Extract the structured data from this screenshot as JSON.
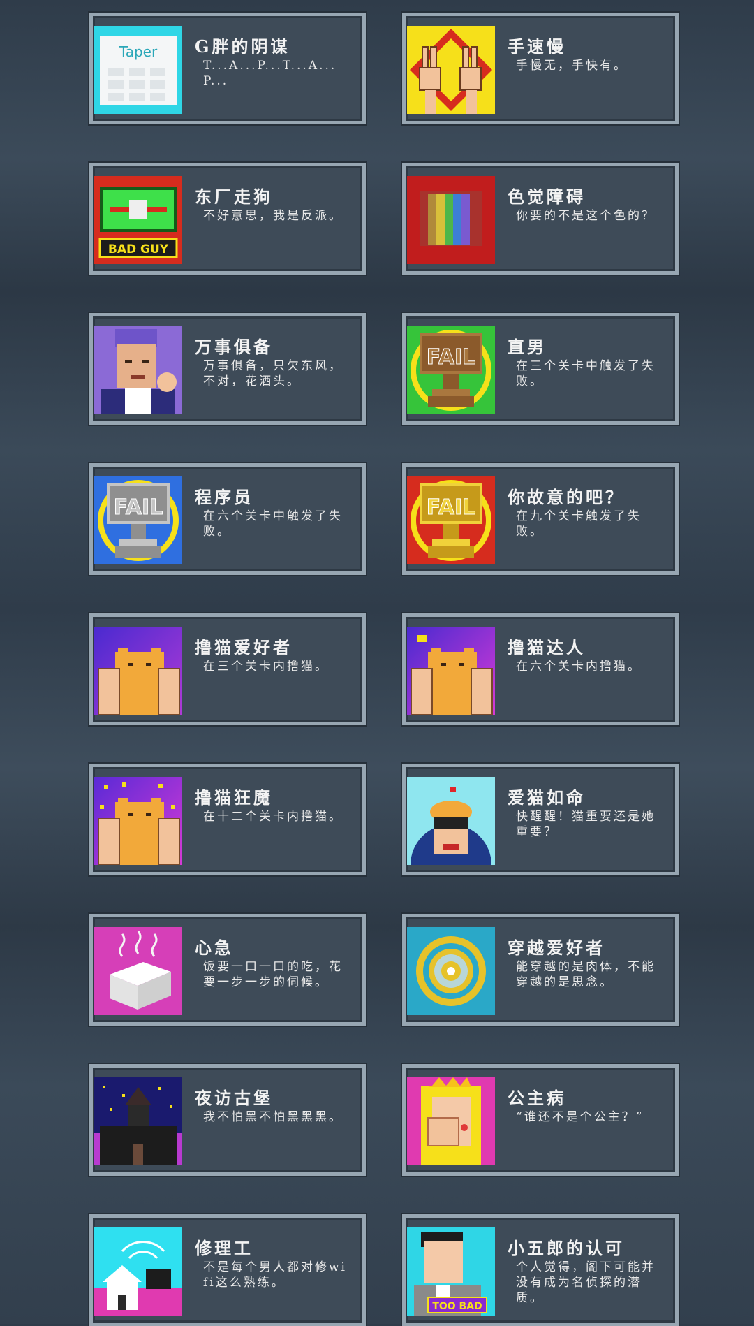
{
  "achievements": [
    {
      "title": "G胖的阴谋",
      "desc": "T...A...P...T...A...P...",
      "icon": "taper-icon"
    },
    {
      "title": "手速慢",
      "desc": "手慢无，手快有。",
      "icon": "victory-hands-icon"
    },
    {
      "title": "东厂走狗",
      "desc": "不好意思，我是反派。",
      "icon": "bad-guy-icon",
      "icon_text": "BAD GUY"
    },
    {
      "title": "色觉障碍",
      "desc": "你要的不是这个色的？",
      "icon": "color-bars-icon"
    },
    {
      "title": "万事俱备",
      "desc": "万事俱备，只欠东风，不对，花洒头。",
      "icon": "ok-gesture-man-icon"
    },
    {
      "title": "直男",
      "desc": "在三个关卡中触发了失败。",
      "icon": "bronze-fail-trophy-icon",
      "icon_text": "FAIL"
    },
    {
      "title": "程序员",
      "desc": "在六个关卡中触发了失败。",
      "icon": "silver-fail-trophy-icon",
      "icon_text": "FAIL"
    },
    {
      "title": "你故意的吧？",
      "desc": "在九个关卡触发了失败。",
      "icon": "gold-fail-trophy-icon",
      "icon_text": "FAIL"
    },
    {
      "title": "撸猫爱好者",
      "desc": "在三个关卡内撸猫。",
      "icon": "cat-petting-icon"
    },
    {
      "title": "撸猫达人",
      "desc": "在六个关卡内撸猫。",
      "icon": "cat-petting-heart-icon"
    },
    {
      "title": "撸猫狂魔",
      "desc": "在十二个关卡内撸猫。",
      "icon": "cat-petting-stars-icon"
    },
    {
      "title": "爱猫如命",
      "desc": "快醒醒！猫重要还是她重要？",
      "icon": "cat-on-head-icon"
    },
    {
      "title": "心急",
      "desc": "饭要一口一口的吃，花要一步一步的伺候。",
      "icon": "steaming-tofu-icon"
    },
    {
      "title": "穿越爱好者",
      "desc": "能穿越的是肉体，不能穿越的是思念。",
      "icon": "portal-vortex-icon"
    },
    {
      "title": "夜访古堡",
      "desc": "我不怕黑不怕黑黑黑。",
      "icon": "night-castle-icon"
    },
    {
      "title": "公主病",
      "desc": "“谁还不是个公主？”",
      "icon": "crying-princess-icon"
    },
    {
      "title": "修理工",
      "desc": "不是每个男人都对修wifi这么熟练。",
      "icon": "wifi-house-icon"
    },
    {
      "title": "小五郎的认可",
      "desc": "个人觉得，阁下可能并没有成为名侦探的潜质。",
      "icon": "detective-too-bad-icon",
      "icon_text": "TOO BAD"
    }
  ],
  "taper_label": "Taper",
  "colors": {
    "card_bg": "#3e4b58",
    "card_border": "#97a6b2",
    "text": "#f3f3f3"
  }
}
